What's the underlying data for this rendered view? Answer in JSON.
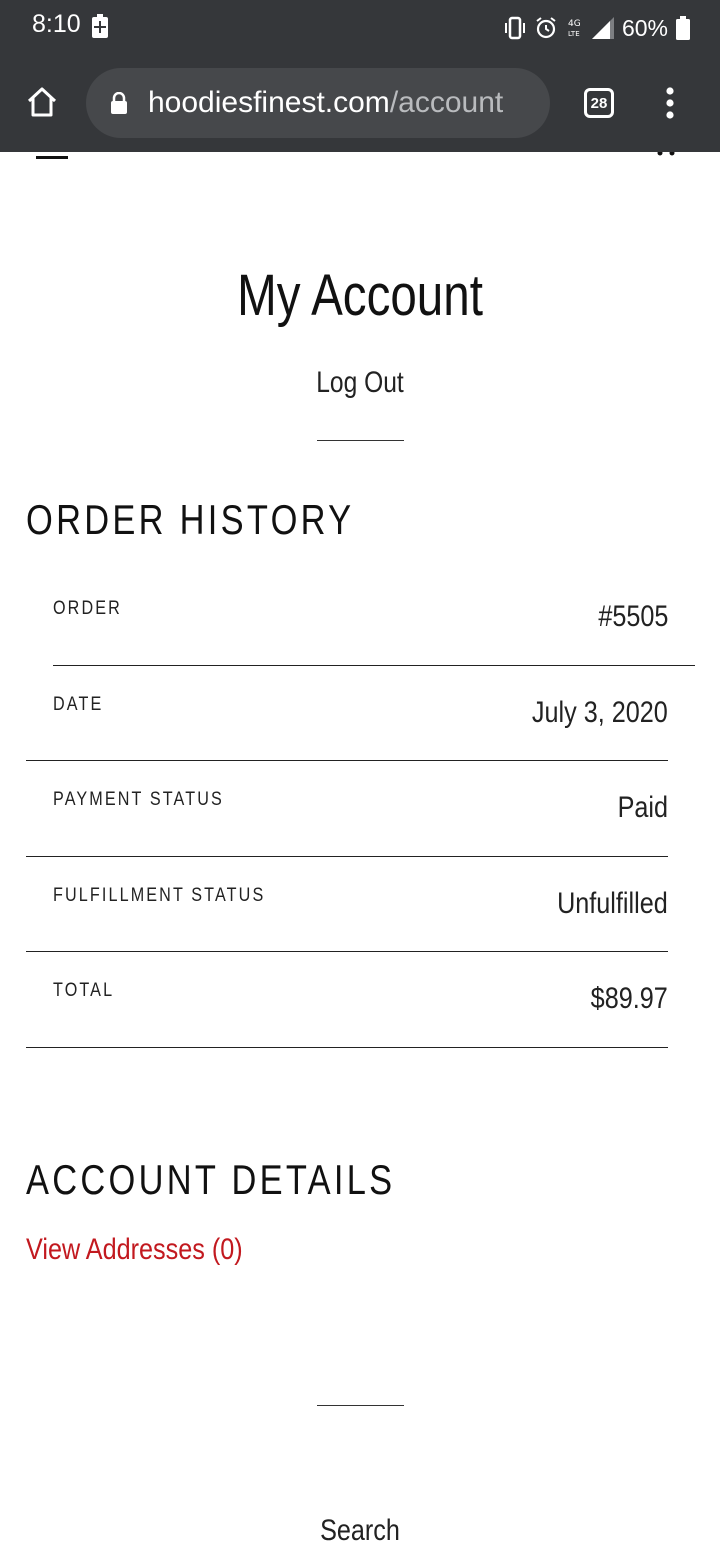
{
  "status_bar": {
    "time": "8:10",
    "battery_percent": "60%",
    "icons": [
      "battery-charging-icon",
      "vibrate-icon",
      "alarm-icon",
      "lte-icon",
      "signal-icon",
      "battery-icon"
    ]
  },
  "browser": {
    "url_host": "hoodiesfinest.com",
    "url_path": "/account",
    "tab_count": "28",
    "icons": [
      "home-icon",
      "lock-icon",
      "tabs-icon",
      "menu-dots-icon"
    ]
  },
  "page": {
    "title": "My Account",
    "logout_label": "Log Out",
    "order_history_heading": "ORDER HISTORY",
    "order_rows": [
      {
        "label": "ORDER",
        "value": "#5505"
      },
      {
        "label": "DATE",
        "value": "July 3, 2020"
      },
      {
        "label": "PAYMENT STATUS",
        "value": "Paid"
      },
      {
        "label": "FULFILLMENT STATUS",
        "value": "Unfulfilled"
      },
      {
        "label": "TOTAL",
        "value": "$89.97"
      }
    ],
    "account_details_heading": "ACCOUNT DETAILS",
    "view_addresses_label": "View Addresses (0)",
    "footer_search_label": "Search"
  },
  "colors": {
    "browser_chrome": "#35373a",
    "url_pill": "#46484b",
    "link_red": "#c2191f",
    "text": "#111111"
  }
}
